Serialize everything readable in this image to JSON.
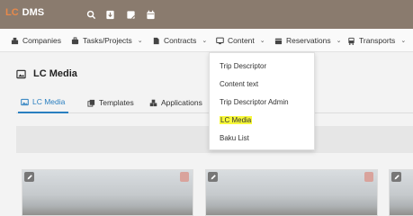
{
  "app": {
    "logo_mark": "LC",
    "logo_text": "DMS",
    "brand_color": "#8a7b6e",
    "accent": "#2a7fc0",
    "highlight": "#f7f83a"
  },
  "topbar": {
    "icons": [
      "search-icon",
      "download-icon",
      "note-icon",
      "calendar-icon"
    ]
  },
  "nav": {
    "companies": "Companies",
    "tasks": "Tasks/Projects",
    "contracts": "Contracts",
    "content": "Content",
    "reservations": "Reservations",
    "transports": "Transports"
  },
  "page": {
    "title": "LC Media"
  },
  "tabs": {
    "lc_media": "LC Media",
    "templates": "Templates",
    "applications": "Applications"
  },
  "dropdown": {
    "items": [
      "Trip Descriptor",
      "Content text",
      "Trip Descriptor Admin",
      "LC Media",
      "Baku List"
    ],
    "highlighted": "LC Media"
  }
}
